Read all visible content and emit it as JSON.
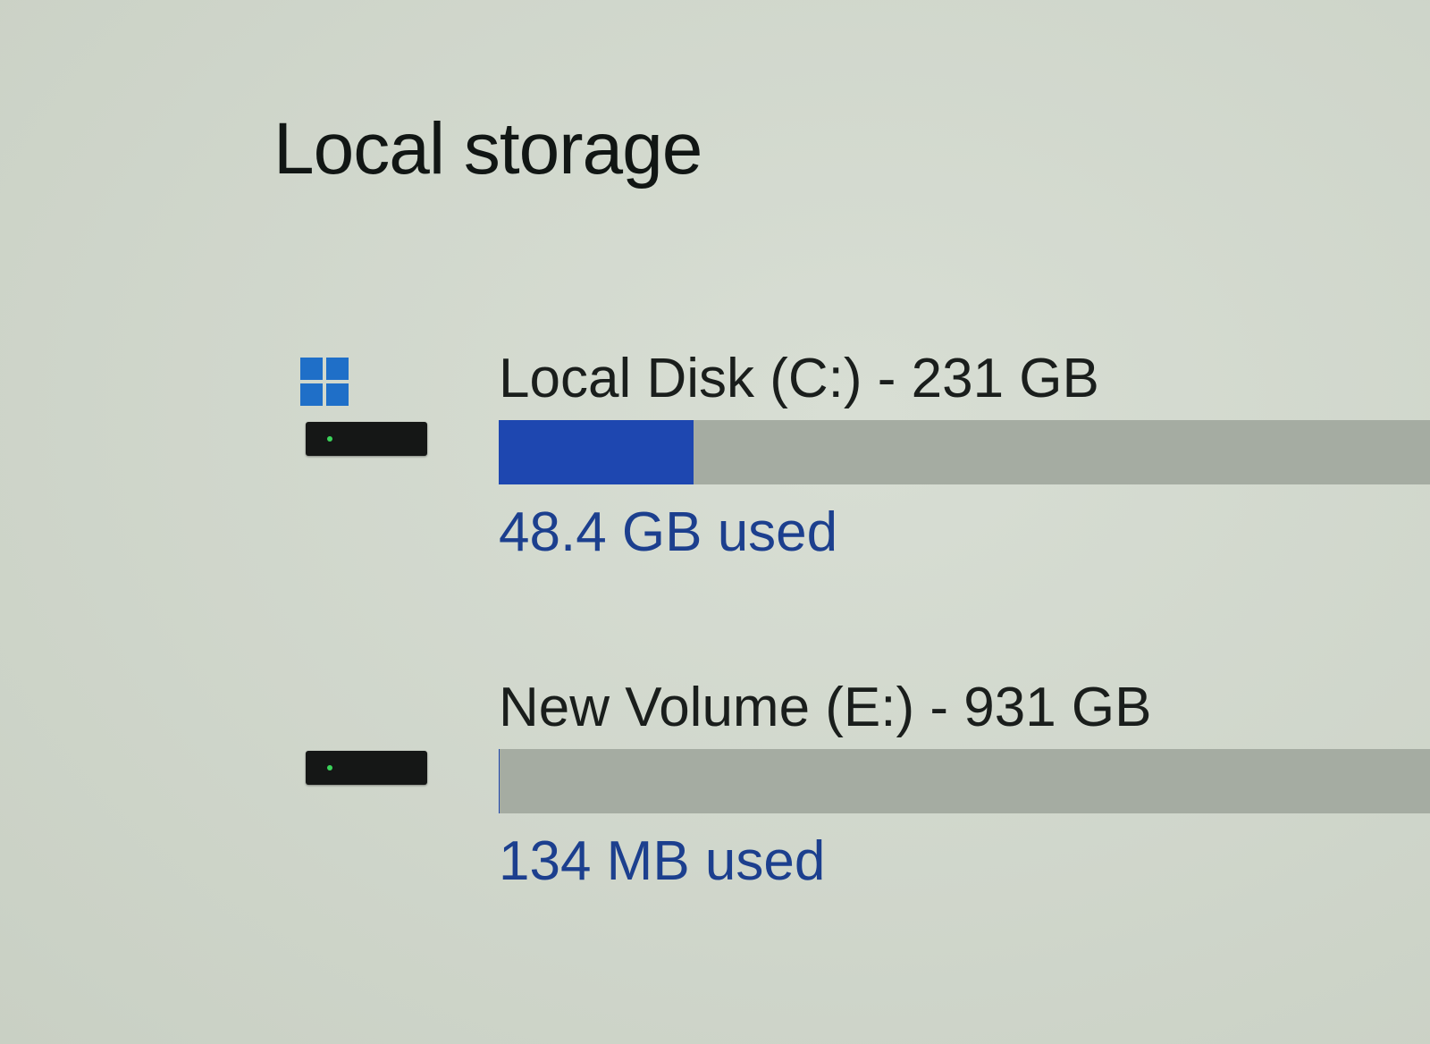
{
  "section": {
    "title": "Local storage"
  },
  "drives": [
    {
      "name": "Local Disk (C:) - 231 GB",
      "used_label": "48.4 GB used",
      "used_fraction": 0.2095,
      "is_system": true,
      "icons": [
        "windows-logo-icon",
        "hard-drive-icon"
      ]
    },
    {
      "name": "New Volume (E:) - 931 GB",
      "used_label": "134 MB used",
      "used_fraction": 0.0001,
      "is_system": false,
      "icons": [
        "hard-drive-icon"
      ]
    }
  ],
  "colors": {
    "background": "#cfd6cb",
    "bar_track": "#a5aca2",
    "bar_fill": "#1e47b0",
    "used_text": "#1c3f8e",
    "windows_logo": "#1f6fc8",
    "drive_led": "#3bd45a"
  }
}
